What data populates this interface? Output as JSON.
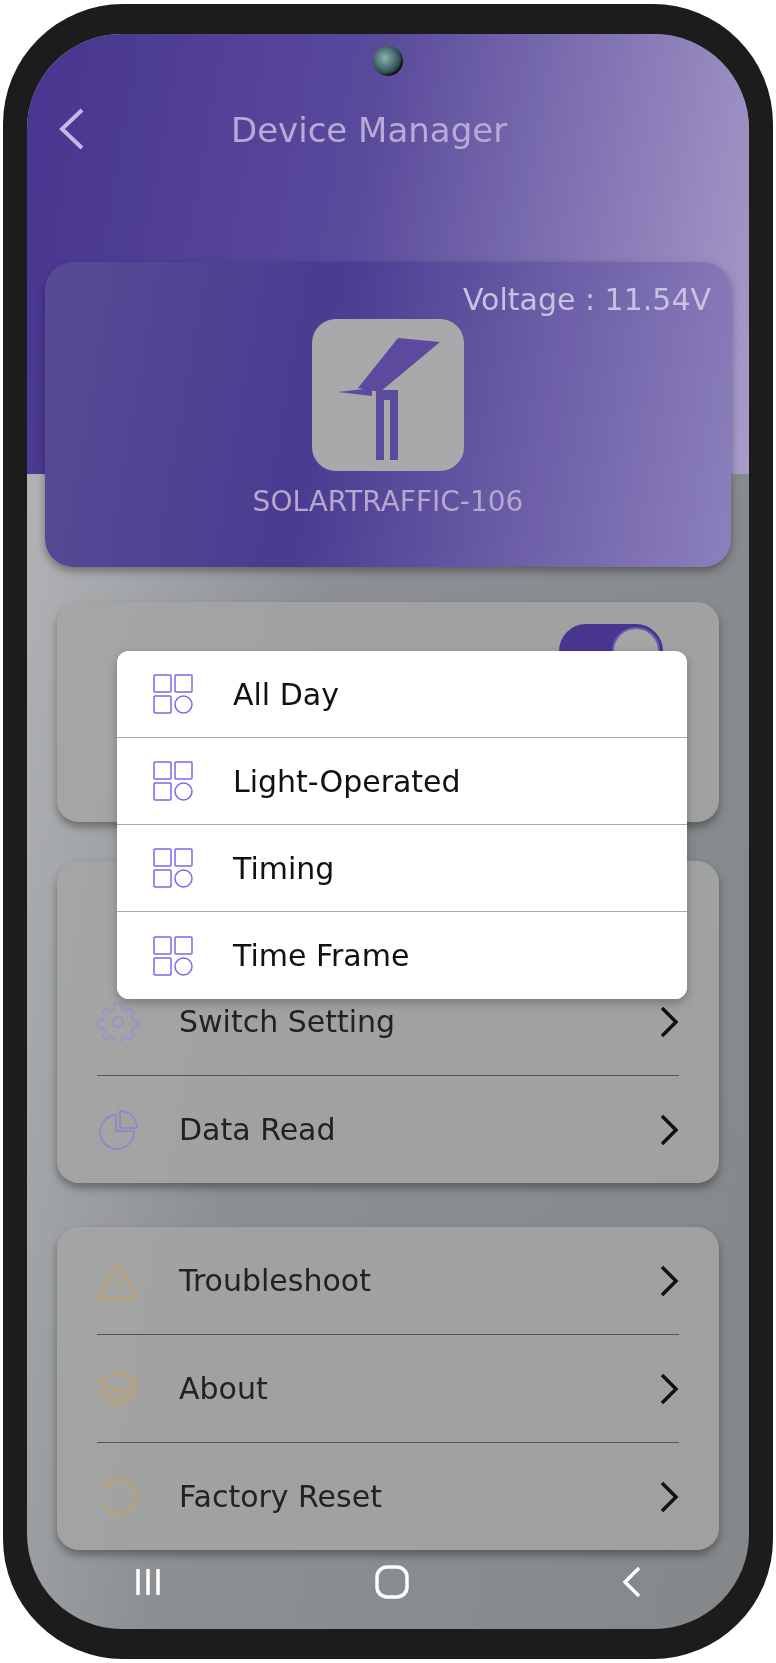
{
  "header": {
    "title": "Device Manager"
  },
  "device": {
    "voltage": "Voltage : 11.54V",
    "name": "SOLARTRAFFIC-106"
  },
  "lighting_card": {
    "switch_on": true
  },
  "mode_menu": [
    {
      "label": "All Day"
    },
    {
      "label": "Light-Operated"
    },
    {
      "label": "Timing"
    },
    {
      "label": "Time Frame"
    }
  ],
  "settings_card": [
    {
      "kind": "gear",
      "label": "Switch Setting"
    },
    {
      "kind": "chart",
      "label": "Data Read"
    }
  ],
  "support_card": [
    {
      "kind": "warning",
      "label": "Troubleshoot"
    },
    {
      "kind": "layers",
      "label": "About"
    },
    {
      "kind": "reset",
      "label": "Factory Reset"
    }
  ]
}
